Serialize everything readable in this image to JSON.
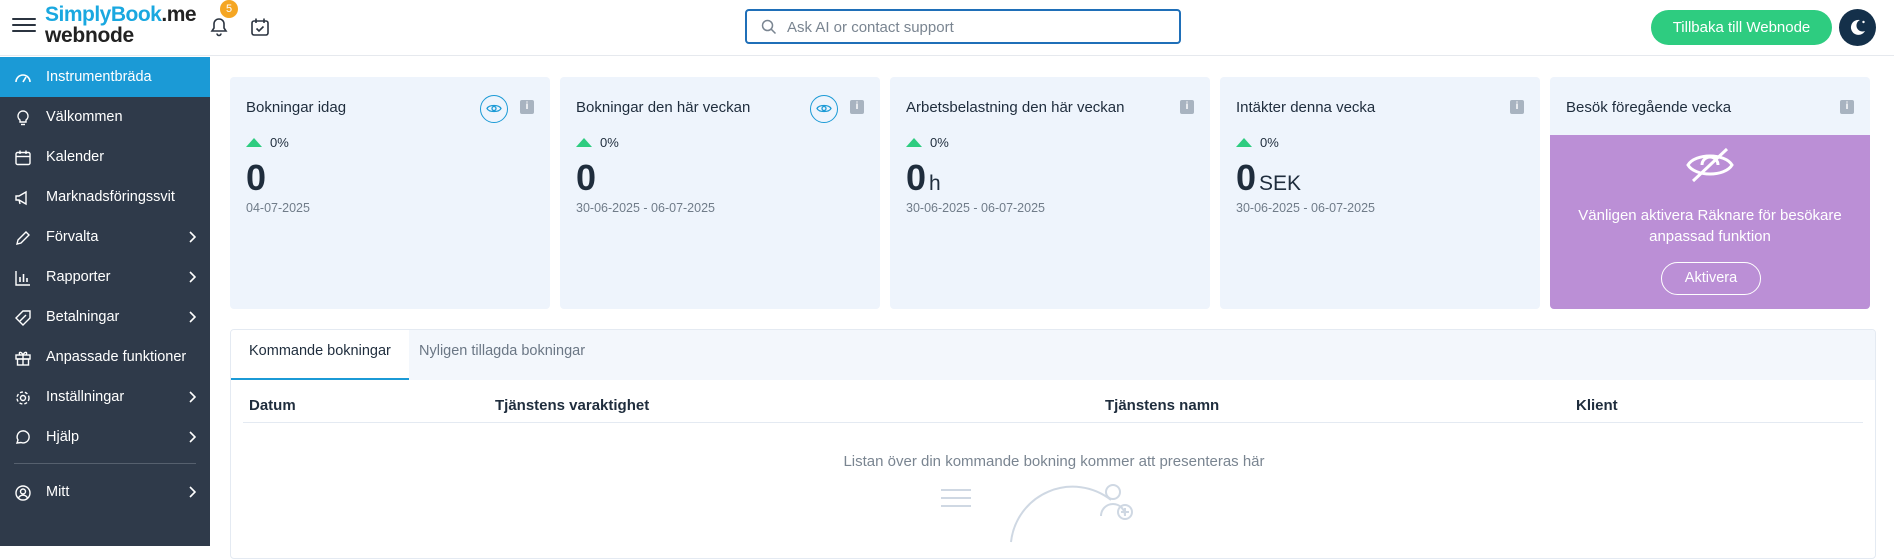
{
  "header": {
    "logo_top_part1": "SimplyBook",
    "logo_top_part2": ".me",
    "logo_bottom": "webnode",
    "notification_count": "5",
    "search_placeholder": "Ask AI or contact support",
    "back_button_label": "Tillbaka till Webnode"
  },
  "sidebar": {
    "items": [
      {
        "label": "Instrumentbräda",
        "icon": "dashboard-icon",
        "active": true,
        "has_submenu": false
      },
      {
        "label": "Välkommen",
        "icon": "lightbulb-icon",
        "active": false,
        "has_submenu": false
      },
      {
        "label": "Kalender",
        "icon": "calendar-icon",
        "active": false,
        "has_submenu": false
      },
      {
        "label": "Marknadsföringssvit",
        "icon": "megaphone-icon",
        "active": false,
        "has_submenu": false
      },
      {
        "label": "Förvalta",
        "icon": "pencil-icon",
        "active": false,
        "has_submenu": true
      },
      {
        "label": "Rapporter",
        "icon": "bar-chart-icon",
        "active": false,
        "has_submenu": true
      },
      {
        "label": "Betalningar",
        "icon": "tag-icon",
        "active": false,
        "has_submenu": true
      },
      {
        "label": "Anpassade funktioner",
        "icon": "gift-icon",
        "active": false,
        "has_submenu": false
      },
      {
        "label": "Inställningar",
        "icon": "gear-icon",
        "active": false,
        "has_submenu": true
      },
      {
        "label": "Hjälp",
        "icon": "chat-icon",
        "active": false,
        "has_submenu": true
      }
    ],
    "user": {
      "label": "Mitt",
      "icon": "user-icon"
    }
  },
  "cards": [
    {
      "title": "Bokningar idag",
      "trend": "0%",
      "value": "0",
      "unit": "",
      "date": "04-07-2025",
      "has_eye": true
    },
    {
      "title": "Bokningar den här veckan",
      "trend": "0%",
      "value": "0",
      "unit": "",
      "date": "30-06-2025 - 06-07-2025",
      "has_eye": true
    },
    {
      "title": "Arbetsbelastning den här veckan",
      "trend": "0%",
      "value": "0",
      "unit": "h",
      "date": "30-06-2025 - 06-07-2025",
      "has_eye": false
    },
    {
      "title": "Intäkter denna vecka",
      "trend": "0%",
      "value": "0",
      "unit": "SEK",
      "date": "30-06-2025 - 06-07-2025",
      "has_eye": false
    }
  ],
  "visits_card": {
    "title": "Besök föregående vecka",
    "message": "Vänligen aktivera Räknare för besökare anpassad funktion",
    "button_label": "Aktivera"
  },
  "info_icon_glyph": "i",
  "bookings": {
    "tabs": [
      {
        "label": "Kommande bokningar",
        "active": true
      },
      {
        "label": "Nyligen tillagda bokningar",
        "active": false
      }
    ],
    "columns": [
      "Datum",
      "Tjänstens varaktighet",
      "Tjänstens namn",
      "Klient"
    ],
    "empty_message": "Listan över din kommande bokning kommer att presenteras här"
  },
  "colors": {
    "accent": "#1b9ad6",
    "sidebar_bg": "#2f3a4a",
    "success": "#2ecc80",
    "card_bg": "#eef4fc",
    "visits_bg": "#bb8fd6"
  }
}
